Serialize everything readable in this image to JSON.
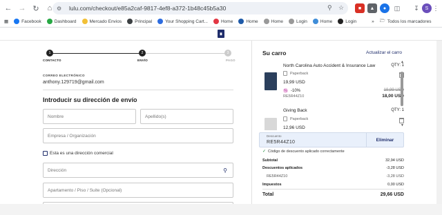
{
  "browser": {
    "url": "lulu.com/checkout/e85a2caf-9817-4ef8-a372-1b48c45b5a30",
    "profile_initial": "S",
    "bookmarks": [
      {
        "label": "Facebook",
        "color": "#1877f2"
      },
      {
        "label": "Dashboard",
        "color": "#27a844"
      },
      {
        "label": "Mercado Envios",
        "color": "#f2c037"
      },
      {
        "label": "Principal",
        "color": "#3c4043"
      },
      {
        "label": "Your Shopping Cart...",
        "color": "#2d6cdf"
      },
      {
        "label": "Home",
        "color": "#e23744"
      },
      {
        "label": "Home",
        "color": "#1e5aa8"
      },
      {
        "label": "Home",
        "color": "#999999"
      },
      {
        "label": "Login",
        "color": "#999999"
      },
      {
        "label": "Home",
        "color": "#3f8dd8"
      },
      {
        "label": "Login",
        "color": "#222222"
      }
    ],
    "bookmarks_overflow": "»",
    "all_bookmarks": "Todos los marcadores"
  },
  "steps": {
    "items": [
      {
        "num": "1",
        "label": "CONTACTO"
      },
      {
        "num": "2",
        "label": "ENVÍO"
      },
      {
        "num": "3",
        "label": "PAGO"
      }
    ]
  },
  "contact": {
    "email_label": "CORREO ELECTRÓNICO",
    "email_value": "anthony.129719@gmail.com"
  },
  "shipping": {
    "title": "Introducir su dirección de envío",
    "first_name_placeholder": "Nombre",
    "last_name_placeholder": "Apellido(s)",
    "company_placeholder": "Empresa / Organización",
    "commercial_label": "Esta es una dirección comercial",
    "address_placeholder": "Dirección",
    "apt_placeholder": "Apartamento / Piso / Suite (Opcional)"
  },
  "cart": {
    "title": "Su carro",
    "update_label": "Actualizar el carro",
    "items": [
      {
        "title": "North Carolina Auto Accident & Insurance Law",
        "qty": "QTY: 1",
        "format": "Paperback",
        "price": "19,99 USD",
        "discount": "-10%",
        "code": "RE5R44Z10",
        "old_price": "19,99 USD",
        "new_price": "18,00 USD"
      },
      {
        "title": "Giving Back",
        "qty": "QTY: 1",
        "format": "Paperback",
        "price": "12,96 USD"
      }
    ],
    "discount": {
      "label": "Descuento",
      "value": "RE5R44Z10",
      "remove_label": "Eliminar",
      "success_msg": "Código de descuento aplicado correctamente"
    },
    "summary": {
      "subtotal_label": "Subtotal",
      "subtotal_value": "32,94 USD",
      "discounts_label": "Descuentos aplicados",
      "discounts_value": "-3,28 USD",
      "code_label": "RE5R44Z10",
      "code_value": "-3,28 USD",
      "taxes_label": "Impuestos",
      "taxes_value": "0,00 USD",
      "total_label": "Total",
      "total_value": "29,66 USD"
    }
  }
}
